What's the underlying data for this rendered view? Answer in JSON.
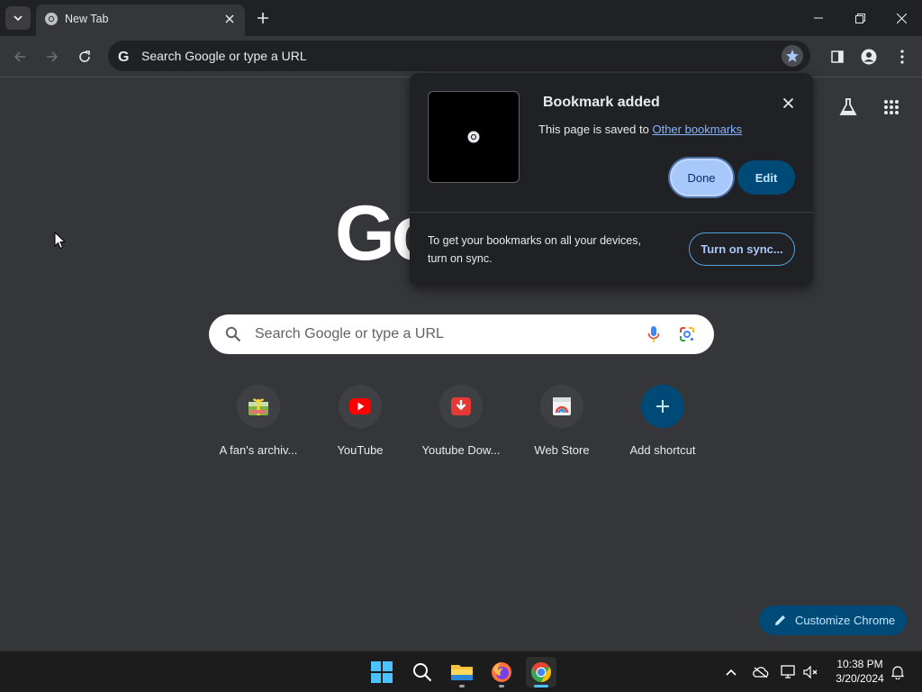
{
  "browser": {
    "tab": {
      "title": "New Tab",
      "close_icon": "close-icon",
      "favicon": "chrome-icon"
    },
    "new_tab_icon": "plus-icon",
    "window_controls": [
      "minimize-icon",
      "restore-icon",
      "close-icon"
    ],
    "toolbar": {
      "back_icon": "arrow-left-icon",
      "forward_icon": "arrow-right-icon",
      "reload_icon": "reload-icon",
      "omnibox_text": "Search Google or type a URL",
      "bookmark_star_icon": "star-filled-icon",
      "side_panel_icon": "side-panel-icon",
      "profile_icon": "profile-icon",
      "menu_icon": "kebab-menu-icon"
    }
  },
  "ntp": {
    "logo_text": "Go",
    "search_placeholder": "Search Google or type a URL",
    "shortcuts": [
      {
        "label": "A fan's archiv...",
        "icon": "archive-gift-icon"
      },
      {
        "label": "YouTube",
        "icon": "youtube-icon"
      },
      {
        "label": "Youtube Dow...",
        "icon": "download-icon"
      },
      {
        "label": "Web Store",
        "icon": "web-store-icon"
      },
      {
        "label": "Add shortcut",
        "icon": "plus-icon"
      }
    ],
    "customize_label": "Customize Chrome"
  },
  "bookmark_bubble": {
    "title": "Bookmark added",
    "message_prefix": "This page is saved to ",
    "folder_link": "Other bookmarks",
    "done_label": "Done",
    "edit_label": "Edit",
    "sync_text": "To get your bookmarks on all your devices, turn on sync.",
    "sync_button": "Turn on sync..."
  },
  "taskbar": {
    "apps": [
      "windows-start-icon",
      "search-icon",
      "file-explorer-icon",
      "firefox-icon",
      "chrome-icon"
    ],
    "time": "10:38 PM",
    "date": "3/20/2024"
  },
  "colors": {
    "page_bg": "#35363a",
    "tabstrip_bg": "#202124",
    "accent_blue": "#a8c7fa",
    "edit_bg": "#004a77"
  }
}
